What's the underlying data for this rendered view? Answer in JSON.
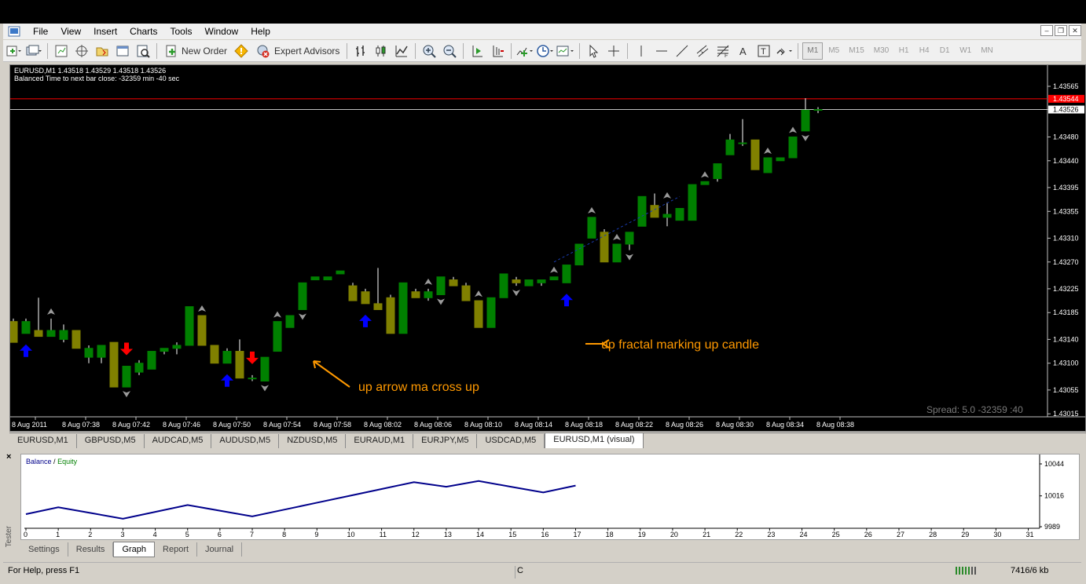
{
  "menu": {
    "items": [
      "File",
      "View",
      "Insert",
      "Charts",
      "Tools",
      "Window",
      "Help"
    ]
  },
  "toolbar": {
    "new_order_label": "New Order",
    "expert_advisors_label": "Expert Advisors",
    "timeframes": [
      "M1",
      "M5",
      "M15",
      "M30",
      "H1",
      "H4",
      "D1",
      "W1",
      "MN"
    ],
    "active_timeframe": "M1"
  },
  "chart": {
    "info_line1": "EURUSD,M1  1.43518 1.43529 1.43518 1.43526",
    "info_line2": "Balanced Time to next bar close: -32359 min -40 sec",
    "spread_text": "Spread: 5.0",
    "countdown_text": "-32359 :40",
    "annotation_fractal": "up fractal marking up candle",
    "annotation_arrow": "up arrow ma cross up",
    "colors": {
      "bull_candle": "#008000",
      "bear_candle": "#808000",
      "up_arrow": "#0000ff",
      "down_arrow": "#ff0000",
      "annotation": "#ff9900",
      "bid_line": "#ff0000",
      "ask_line": "#c0c0c0"
    }
  },
  "chart_data": {
    "type": "candlestick",
    "symbol": "EURUSD",
    "timeframe": "M1",
    "price_ticks": [
      "1.43565",
      "1.43526",
      "1.43480",
      "1.43440",
      "1.43395",
      "1.43355",
      "1.43310",
      "1.43270",
      "1.43225",
      "1.43185",
      "1.43140",
      "1.43100",
      "1.43055",
      "1.43015"
    ],
    "current_price_label": "1.43526",
    "bid_price_label": "1.43544",
    "time_ticks": [
      "8 Aug 2011",
      "8 Aug 07:38",
      "8 Aug 07:42",
      "8 Aug 07:46",
      "8 Aug 07:50",
      "8 Aug 07:54",
      "8 Aug 07:58",
      "8 Aug 08:02",
      "8 Aug 08:06",
      "8 Aug 08:10",
      "8 Aug 08:14",
      "8 Aug 08:18",
      "8 Aug 08:22",
      "8 Aug 08:26",
      "8 Aug 08:30",
      "8 Aug 08:34",
      "8 Aug 08:38"
    ],
    "ylim": [
      1.4301,
      1.4359
    ],
    "candles": [
      [
        1.4317,
        1.43175,
        1.43135,
        1.43135
      ],
      [
        1.4315,
        1.43175,
        1.4315,
        1.4317
      ],
      [
        1.43155,
        1.4321,
        1.43145,
        1.43145
      ],
      [
        1.43145,
        1.43175,
        1.43145,
        1.43155
      ],
      [
        1.4314,
        1.43165,
        1.43135,
        1.43155
      ],
      [
        1.43155,
        1.43155,
        1.43125,
        1.43125
      ],
      [
        1.4311,
        1.4313,
        1.431,
        1.43125
      ],
      [
        1.4311,
        1.43125,
        1.431,
        1.4313
      ],
      [
        1.43135,
        1.43135,
        1.4306,
        1.4306
      ],
      [
        1.4306,
        1.43095,
        1.4306,
        1.43095
      ],
      [
        1.43085,
        1.43105,
        1.4308,
        1.431
      ],
      [
        1.4309,
        1.4311,
        1.4309,
        1.4312
      ],
      [
        1.4312,
        1.4312,
        1.43115,
        1.43125
      ],
      [
        1.43125,
        1.43135,
        1.43115,
        1.4313
      ],
      [
        1.4313,
        1.43195,
        1.4313,
        1.43195
      ],
      [
        1.4318,
        1.4318,
        1.4313,
        1.4313
      ],
      [
        1.4313,
        1.4313,
        1.431,
        1.431
      ],
      [
        1.431,
        1.43125,
        1.431,
        1.4312
      ],
      [
        1.4312,
        1.4314,
        1.43075,
        1.43075
      ],
      [
        1.43075,
        1.4308,
        1.4307,
        1.43075
      ],
      [
        1.4307,
        1.4311,
        1.4307,
        1.4311
      ],
      [
        1.4312,
        1.4317,
        1.4312,
        1.4317
      ],
      [
        1.4316,
        1.4318,
        1.4316,
        1.4318
      ],
      [
        1.4319,
        1.43235,
        1.4319,
        1.43235
      ],
      [
        1.4324,
        1.43245,
        1.4324,
        1.43245
      ],
      [
        1.4324,
        1.43245,
        1.4324,
        1.43245
      ],
      [
        1.4325,
        1.43255,
        1.4325,
        1.43255
      ],
      [
        1.4323,
        1.43235,
        1.43205,
        1.43205
      ],
      [
        1.4322,
        1.43225,
        1.432,
        1.432
      ],
      [
        1.432,
        1.4326,
        1.4319,
        1.4319
      ],
      [
        1.4321,
        1.43215,
        1.4315,
        1.4315
      ],
      [
        1.4315,
        1.43235,
        1.4315,
        1.43235
      ],
      [
        1.4322,
        1.43225,
        1.4321,
        1.4321
      ],
      [
        1.4321,
        1.43225,
        1.43205,
        1.4322
      ],
      [
        1.43215,
        1.43245,
        1.43215,
        1.43245
      ],
      [
        1.4324,
        1.43245,
        1.4323,
        1.4323
      ],
      [
        1.4323,
        1.43235,
        1.43205,
        1.43205
      ],
      [
        1.43205,
        1.43205,
        1.4316,
        1.4316
      ],
      [
        1.4316,
        1.4321,
        1.4316,
        1.4321
      ],
      [
        1.4321,
        1.4325,
        1.4321,
        1.4325
      ],
      [
        1.4324,
        1.43245,
        1.4323,
        1.43235
      ],
      [
        1.4323,
        1.4324,
        1.4323,
        1.4324
      ],
      [
        1.43235,
        1.4324,
        1.4323,
        1.4324
      ],
      [
        1.4324,
        1.43245,
        1.4324,
        1.43245
      ],
      [
        1.43235,
        1.43265,
        1.43235,
        1.43265
      ],
      [
        1.43265,
        1.433,
        1.43265,
        1.433
      ],
      [
        1.4331,
        1.43345,
        1.4331,
        1.43345
      ],
      [
        1.4332,
        1.43325,
        1.4327,
        1.4327
      ],
      [
        1.4327,
        1.433,
        1.4327,
        1.433
      ],
      [
        1.433,
        1.4332,
        1.4329,
        1.4332
      ],
      [
        1.4333,
        1.4338,
        1.4333,
        1.4338
      ],
      [
        1.43365,
        1.43385,
        1.43345,
        1.43345
      ],
      [
        1.43345,
        1.4337,
        1.4333,
        1.4335
      ],
      [
        1.4334,
        1.4336,
        1.4334,
        1.4336
      ],
      [
        1.4334,
        1.434,
        1.4334,
        1.434
      ],
      [
        1.434,
        1.43405,
        1.434,
        1.43405
      ],
      [
        1.4341,
        1.43435,
        1.43405,
        1.43435
      ],
      [
        1.4345,
        1.43485,
        1.4345,
        1.43475
      ],
      [
        1.4347,
        1.4351,
        1.43465,
        1.4347
      ],
      [
        1.43475,
        1.43475,
        1.43425,
        1.43425
      ],
      [
        1.4342,
        1.43445,
        1.4342,
        1.43445
      ],
      [
        1.4344,
        1.43445,
        1.4344,
        1.43445
      ],
      [
        1.43445,
        1.4348,
        1.43445,
        1.4348
      ],
      [
        1.4349,
        1.43545,
        1.4349,
        1.43525
      ],
      [
        1.43525,
        1.4353,
        1.4352,
        1.43526
      ]
    ],
    "up_arrows": [
      1,
      17,
      28,
      44
    ],
    "down_arrows": [
      9,
      19
    ],
    "up_fractals": [
      3,
      15,
      21,
      33,
      37,
      43,
      46,
      48,
      52,
      55,
      60,
      62,
      71,
      74
    ],
    "down_fractals": [
      9,
      20,
      23,
      34,
      40,
      49,
      63,
      73
    ]
  },
  "symbol_tabs": [
    "EURUSD,M1",
    "GBPUSD,M5",
    "AUDCAD,M5",
    "AUDUSD,M5",
    "NZDUSD,M5",
    "EURAUD,M1",
    "EURJPY,M5",
    "USDCAD,M5",
    "EURUSD,M1 (visual)"
  ],
  "active_symbol_tab": "EURUSD,M1 (visual)",
  "tester": {
    "side_label": "Tester",
    "legend_balance": "Balance",
    "legend_sep": "/",
    "legend_equity": "Equity",
    "tabs": [
      "Settings",
      "Results",
      "Graph",
      "Report",
      "Journal"
    ],
    "active_tab": "Graph"
  },
  "graph_data": {
    "type": "line",
    "series": [
      {
        "name": "Balance",
        "x": [
          0,
          1,
          2,
          3,
          4,
          5,
          6,
          7,
          8,
          9,
          10,
          11,
          12,
          13,
          14,
          15,
          16,
          17
        ],
        "values": [
          10000,
          10006,
          10001,
          9996,
          10002,
          10008,
          10003,
          9998,
          10004,
          10010,
          10016,
          10022,
          10028,
          10024,
          10029,
          10024,
          10019,
          10025
        ]
      }
    ],
    "x_ticks": [
      "0",
      "1",
      "2",
      "3",
      "4",
      "5",
      "6",
      "7",
      "8",
      "9",
      "10",
      "11",
      "12",
      "13",
      "14",
      "15",
      "16",
      "17",
      "18",
      "19",
      "20",
      "21",
      "22",
      "23",
      "24",
      "25",
      "26",
      "27",
      "28",
      "29",
      "30",
      "31"
    ],
    "y_ticks": [
      "10044",
      "10016",
      "9989"
    ],
    "ylim": [
      9989,
      10044
    ]
  },
  "status": {
    "help": "For Help, press F1",
    "section": "C",
    "traffic": "7416/6 kb"
  }
}
